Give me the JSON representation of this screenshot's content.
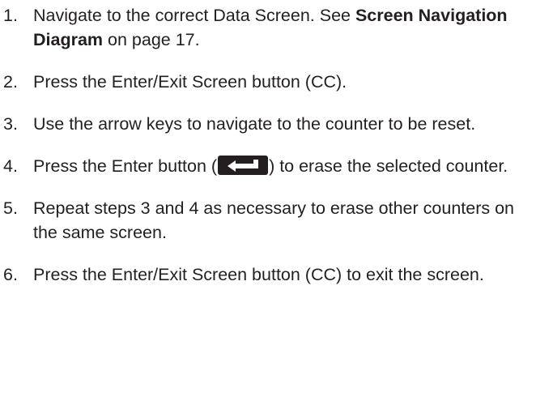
{
  "steps": [
    {
      "number": "1.",
      "text_before": "Navigate to the correct Data Screen. See ",
      "bold": "Screen Navigation Diagram",
      "text_after": " on page 17."
    },
    {
      "number": "2.",
      "text": "Press the Enter/Exit Screen button (CC)."
    },
    {
      "number": "3.",
      "text": "Use the arrow keys to navigate to the counter to be reset."
    },
    {
      "number": "4.",
      "text_before": "Press the Enter button (",
      "icon": "enter-key-icon",
      "text_after": ") to erase the selected counter."
    },
    {
      "number": "5.",
      "text": "Repeat steps 3 and 4 as necessary to erase other counters on the same screen."
    },
    {
      "number": "6.",
      "text": "Press the Enter/Exit Screen button (CC) to exit the screen."
    }
  ],
  "colors": {
    "text": "#231f20",
    "icon_bg": "#231f20",
    "icon_fg": "#ffffff"
  }
}
